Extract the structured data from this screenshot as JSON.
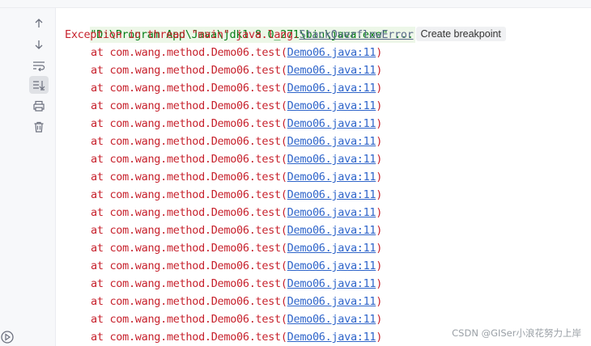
{
  "toolbar": {
    "icons": [
      "arrow-up-icon",
      "arrow-down-icon",
      "soft-wrap-icon",
      "scroll-to-end-icon",
      "print-icon",
      "trash-icon"
    ],
    "run_icon": "run-icon"
  },
  "console": {
    "command_line": "\"D:\\Program App\\Java\\jdk1.8.0_271\\bin\\java.exe\" ...",
    "exception_prefix": "Exception in thread \"main\" java.lang.",
    "exception_class": "StackOverflowError",
    "create_breakpoint": "Create breakpoint",
    "trace_prefix": "at com.wang.method.Demo06.test(",
    "trace_link": "Demo06.java:11",
    "trace_suffix": ")",
    "trace_line_count": 17
  },
  "watermark": "CSDN @GISer小浪花努力上岸",
  "colors": {
    "error_red": "#c7222d",
    "link_blue": "#2f65ca",
    "command_green": "#067d17",
    "command_bg": "#edf7e8"
  }
}
